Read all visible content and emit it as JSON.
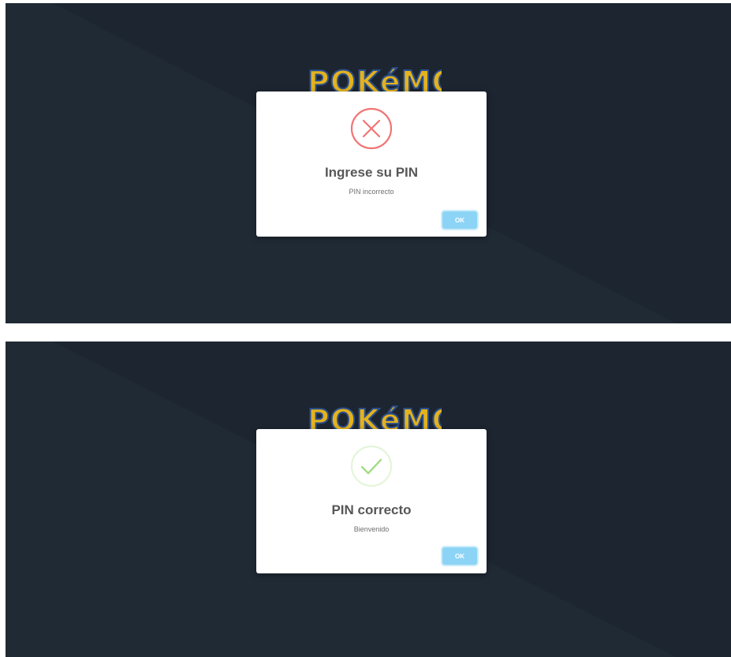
{
  "colors": {
    "background_dark": "#1c2530",
    "background_light": "#202a35",
    "error_red": "#f27474",
    "success_green": "#a5dc86",
    "ok_button": "#8cd4f5",
    "logo_yellow": "#e3b21e",
    "logo_outline": "#2b4f8c"
  },
  "screens": [
    {
      "logo_text": "POKéMON",
      "dialog": {
        "icon": "error-x-icon",
        "title": "Ingrese su PIN",
        "text": "PIN incorrecto",
        "ok_label": "OK"
      }
    },
    {
      "logo_text": "POKéMON",
      "dialog": {
        "icon": "success-check-icon",
        "title": "PIN correcto",
        "text": "Bienvenido",
        "ok_label": "OK"
      }
    }
  ]
}
